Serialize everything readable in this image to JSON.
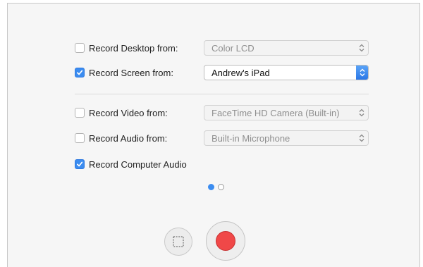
{
  "options": {
    "desktop": {
      "label": "Record Desktop from:",
      "checked": false,
      "select_value": "Color LCD"
    },
    "screen": {
      "label": "Record Screen from:",
      "checked": true,
      "select_value": "Andrew's iPad"
    },
    "video": {
      "label": "Record Video from:",
      "checked": false,
      "select_value": "FaceTime HD Camera (Built-in)"
    },
    "audio": {
      "label": "Record Audio from:",
      "checked": false,
      "select_value": "Built-in Microphone"
    },
    "computer_audio": {
      "label": "Record Computer Audio",
      "checked": true
    }
  },
  "pagination": {
    "current": 1,
    "total": 2
  },
  "controls": {
    "select_area_icon": "dashed-selection-icon",
    "record_icon": "record-icon"
  },
  "colors": {
    "accent": "#3b8cf0",
    "record": "#f04848"
  }
}
